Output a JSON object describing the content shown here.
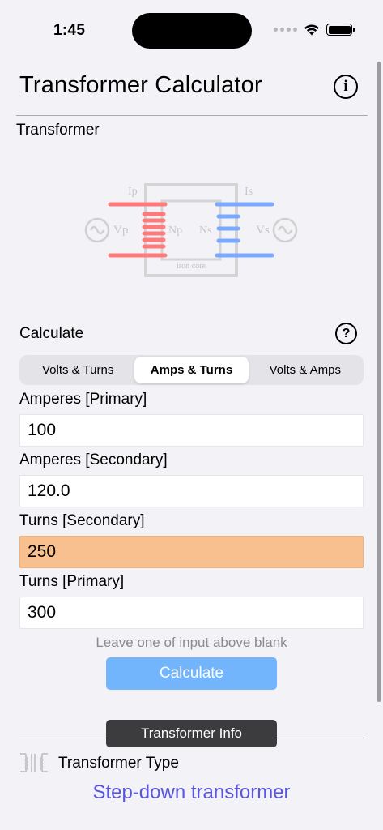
{
  "status_bar": {
    "time": "1:45"
  },
  "header": {
    "title": "Transformer Calculator",
    "info_icon": "info-circle-icon"
  },
  "diagram_section": {
    "label": "Transformer"
  },
  "diagram": {
    "ip": "Ip",
    "is": "Is",
    "vp": "Vp",
    "vs": "Vs",
    "np": "Np",
    "ns": "Ns",
    "core": "iron core",
    "primary_color": "#ff7b7b",
    "secondary_color": "#7aa9ff",
    "core_color": "#d4d4d4"
  },
  "calculate": {
    "label": "Calculate",
    "help_icon": "question-circle-icon",
    "tabs": [
      {
        "label": "Volts & Turns",
        "selected": false
      },
      {
        "label": "Amps & Turns",
        "selected": true
      },
      {
        "label": "Volts & Amps",
        "selected": false
      }
    ]
  },
  "fields": [
    {
      "label": "Amperes [Primary]",
      "value": "100",
      "highlighted": false
    },
    {
      "label": "Amperes [Secondary]",
      "value": "120.0",
      "highlighted": false
    },
    {
      "label": "Turns [Secondary]",
      "value": "250",
      "highlighted": true
    },
    {
      "label": "Turns [Primary]",
      "value": "300",
      "highlighted": false
    }
  ],
  "hint": "Leave one of input above blank",
  "calculate_button": {
    "label": "Calculate",
    "color": "#72b5fc"
  },
  "info": {
    "badge": "Transformer Info",
    "type_label": "Transformer Type",
    "type_value": "Step-down transformer",
    "type_value_color": "#5b56e0",
    "highlight_color": "#f8c08e"
  }
}
